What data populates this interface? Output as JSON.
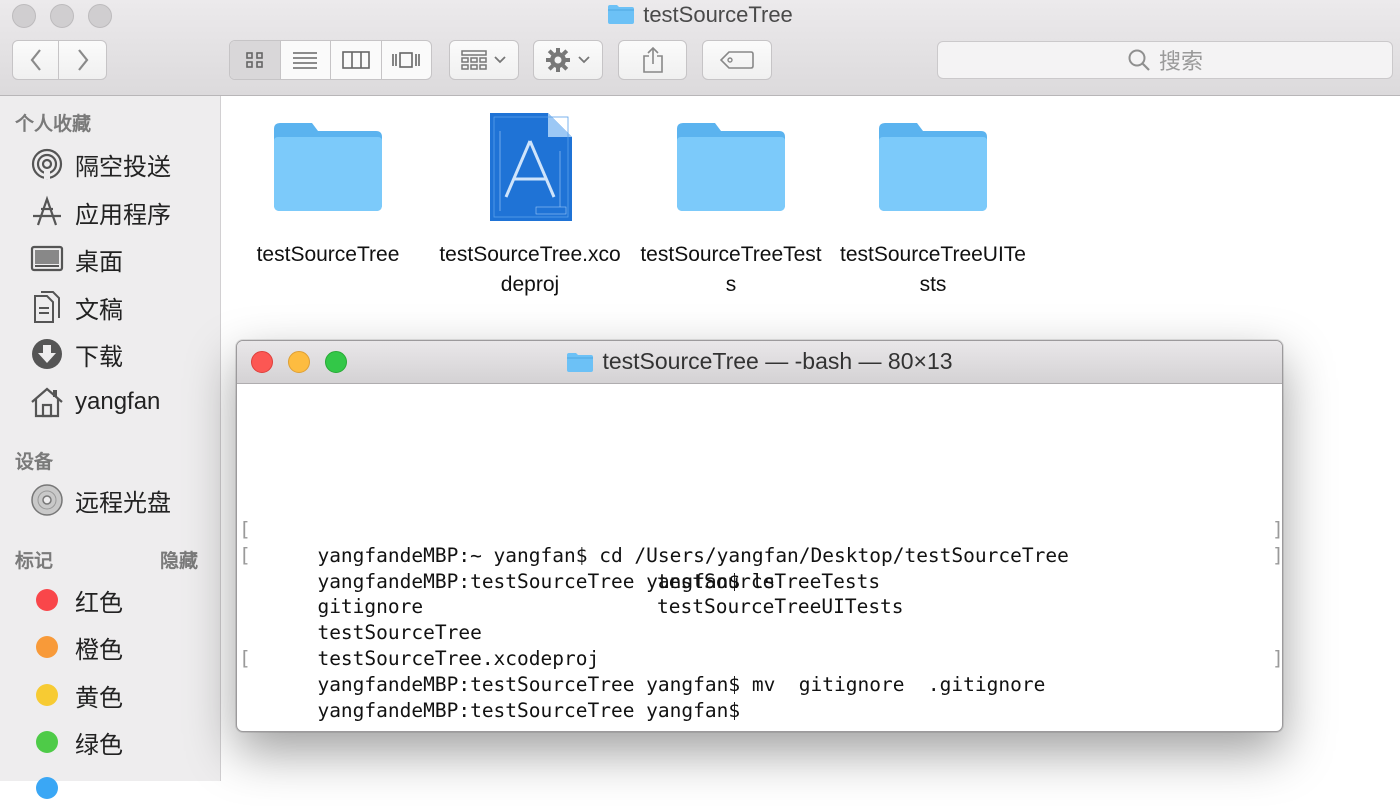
{
  "window": {
    "title": "testSourceTree"
  },
  "toolbar": {
    "back_icon": "chevron-left-icon",
    "forward_icon": "chevron-right-icon",
    "view_modes": [
      "icon-view-icon",
      "list-view-icon",
      "column-view-icon",
      "cover-flow-icon"
    ],
    "arrange_icon": "grid-arrange-icon",
    "action_icon": "gear-icon",
    "share_icon": "share-icon",
    "tag_icon": "tag-icon",
    "search_placeholder": "搜索"
  },
  "sidebar": {
    "favorites_header": "个人收藏",
    "favorites": [
      {
        "label": "隔空投送",
        "icon": "airdrop-icon"
      },
      {
        "label": "应用程序",
        "icon": "applications-icon"
      },
      {
        "label": "桌面",
        "icon": "desktop-icon"
      },
      {
        "label": "文稿",
        "icon": "documents-icon"
      },
      {
        "label": "下载",
        "icon": "downloads-icon"
      },
      {
        "label": "yangfan",
        "icon": "home-icon"
      }
    ],
    "devices_header": "设备",
    "devices": [
      {
        "label": "远程光盘",
        "icon": "disc-icon"
      }
    ],
    "tags_header": "标记",
    "tags_hide": "隐藏",
    "tags": [
      {
        "label": "红色",
        "color": "#f9464a"
      },
      {
        "label": "橙色",
        "color": "#f89a39"
      },
      {
        "label": "黄色",
        "color": "#f7cb33"
      },
      {
        "label": "绿色",
        "color": "#4ecb48"
      }
    ],
    "partial_tag_color": "#3aa7f5"
  },
  "files": [
    {
      "name": "testSourceTree",
      "kind": "folder"
    },
    {
      "name": "testSourceTree.xcodeproj",
      "kind": "xcodeproj"
    },
    {
      "name": "testSourceTreeTests",
      "kind": "folder"
    },
    {
      "name": "testSourceTreeUITests",
      "kind": "folder"
    }
  ],
  "terminal": {
    "title": "testSourceTree — -bash — 80×13",
    "lines": [
      {
        "text": "yangfandeMBP:~ yangfan$ cd /Users/yangfan/Desktop/testSourceTree",
        "marked": true
      },
      {
        "text": "yangfandeMBP:testSourceTree yangfan$ ls",
        "marked": true
      },
      {
        "text": "gitignore",
        "col2": "testSourceTreeTests",
        "marked": false
      },
      {
        "text": "testSourceTree",
        "col2": "testSourceTreeUITests",
        "marked": false
      },
      {
        "text": "testSourceTree.xcodeproj",
        "marked": false
      },
      {
        "text": "yangfandeMBP:testSourceTree yangfan$ mv  gitignore  .gitignore",
        "marked": true
      },
      {
        "text": "yangfandeMBP:testSourceTree yangfan$",
        "marked": false
      }
    ]
  },
  "colors": {
    "folder_blue": "#6cc1f6",
    "close": "#fc5753",
    "minimize": "#fdbc40",
    "zoom": "#33c748"
  }
}
